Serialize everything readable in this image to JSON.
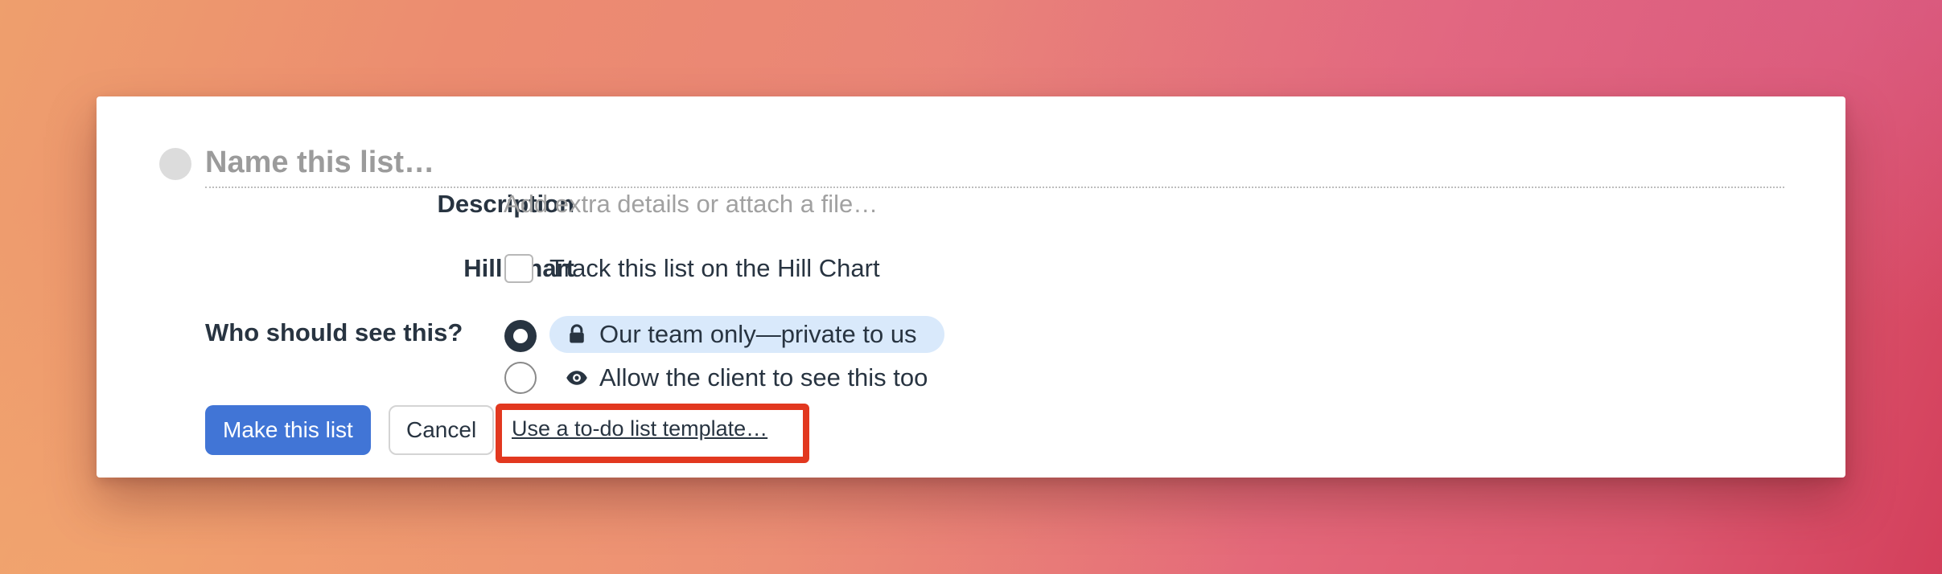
{
  "form": {
    "title_placeholder": "Name this list…",
    "description": {
      "label": "Description",
      "placeholder": "Add extra details or attach a file…"
    },
    "hill_chart": {
      "label": "Hill Chart",
      "checkbox_label": "Track this list on the Hill Chart",
      "checked": false
    },
    "visibility": {
      "label": "Who should see this?",
      "options": [
        {
          "label": "Our team only—private to us",
          "icon": "lock-icon",
          "selected": true
        },
        {
          "label": "Allow the client to see this too",
          "icon": "eye-icon",
          "selected": false
        }
      ]
    },
    "actions": {
      "submit_label": "Make this list",
      "cancel_label": "Cancel",
      "template_link_label": "Use a to-do list template…"
    }
  },
  "colors": {
    "primary_button": "#4175d6",
    "highlight_border": "#e2381f",
    "selected_pill": "#d9e9fb",
    "text": "#283441"
  }
}
